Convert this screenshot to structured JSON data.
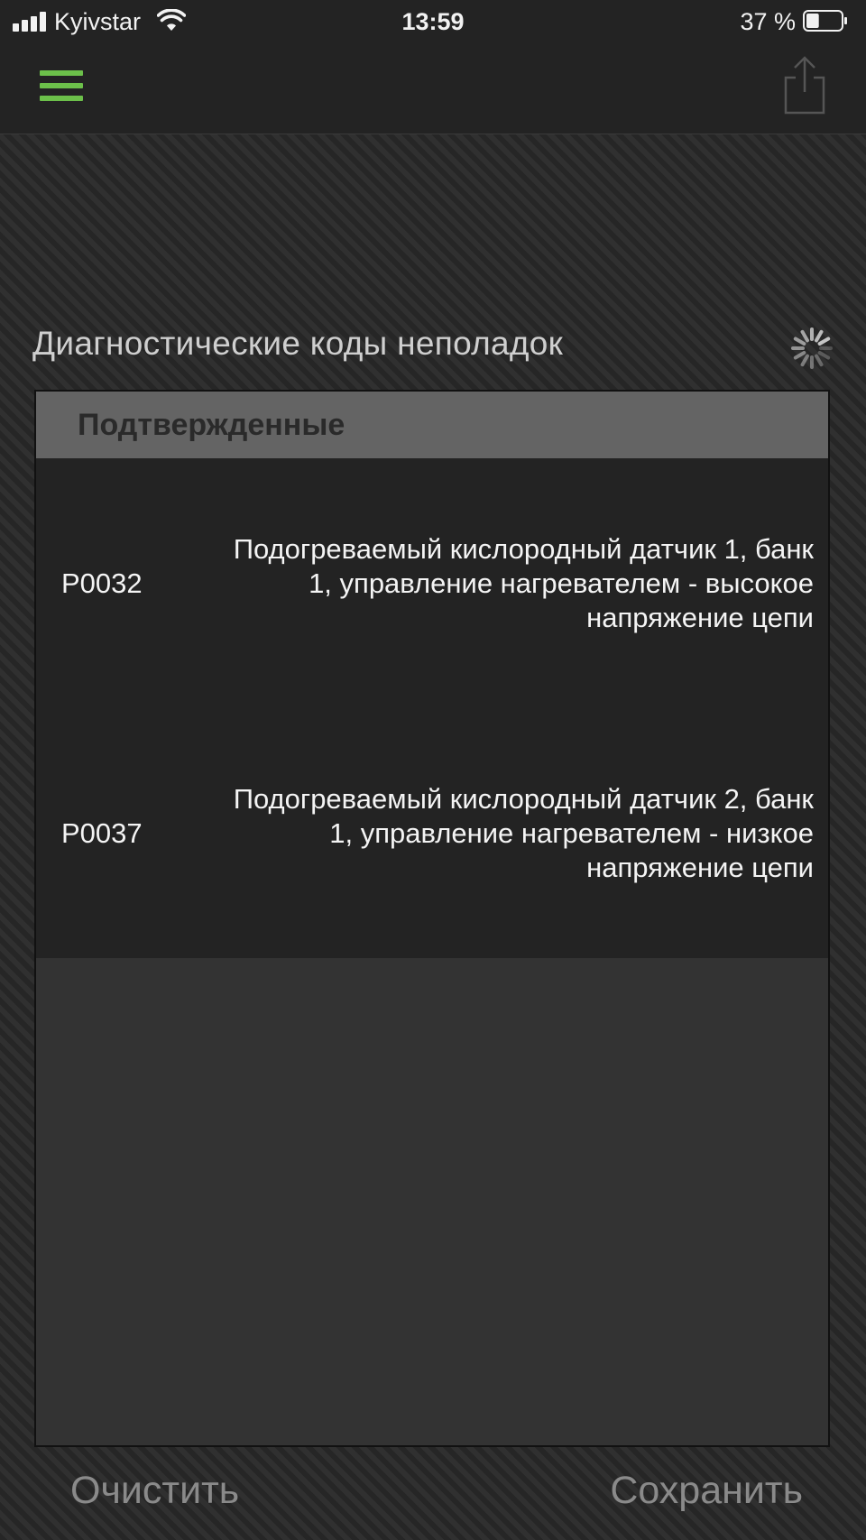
{
  "status_bar": {
    "carrier": "Kyivstar",
    "time": "13:59",
    "battery_percent": "37 %",
    "battery_level": 0.37,
    "icons": [
      "signal-icon",
      "wifi-icon",
      "battery-icon"
    ]
  },
  "nav": {
    "menu_icon": "hamburger-menu-icon",
    "share_icon": "share-icon"
  },
  "section": {
    "title": "Диагностические коды неполадок",
    "loading_icon": "loading-spinner-icon"
  },
  "panel": {
    "header": "Подтвержденные",
    "codes": [
      {
        "code": "P0032",
        "description": "Подогреваемый кислородный датчик 1, банк 1, управление нагревателем - высокое напряжение цепи"
      },
      {
        "code": "P0037",
        "description": "Подогреваемый кислородный датчик 2, банк 1, управление нагревателем - низкое напряжение цепи"
      }
    ]
  },
  "actions": {
    "clear_label": "Очистить",
    "save_label": "Сохранить"
  },
  "colors": {
    "accent": "#6cc04a",
    "panel_header": "#646464",
    "panel_body": "#232323",
    "button_text": "#8a8a8a"
  }
}
